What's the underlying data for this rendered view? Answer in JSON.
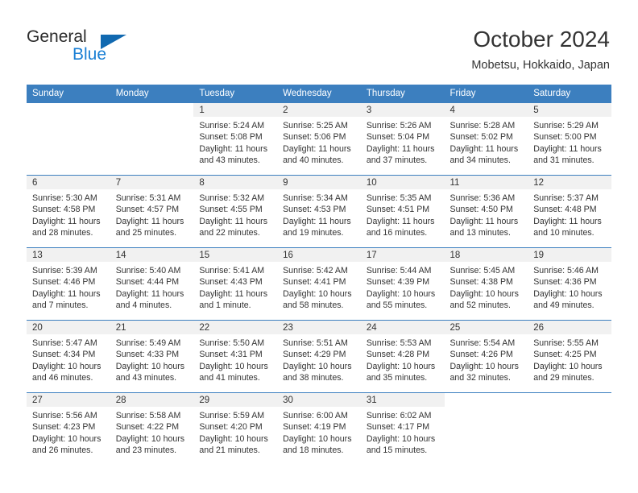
{
  "logo": {
    "word_top": "General",
    "word_bottom": "Blue",
    "triangle_color": "#1169b0",
    "blue_color": "#1a7fd4"
  },
  "header": {
    "title": "October 2024",
    "subtitle": "Mobetsu, Hokkaido, Japan"
  },
  "theme": {
    "header_blue": "#3c7fbf",
    "daynum_band": "#f1f1f1",
    "text": "#333333"
  },
  "weekday_headers": [
    "Sunday",
    "Monday",
    "Tuesday",
    "Wednesday",
    "Thursday",
    "Friday",
    "Saturday"
  ],
  "weeks": [
    [
      {
        "day": "",
        "sunrise": "",
        "sunset": "",
        "daylight_line1": "",
        "daylight_line2": ""
      },
      {
        "day": "",
        "sunrise": "",
        "sunset": "",
        "daylight_line1": "",
        "daylight_line2": ""
      },
      {
        "day": "1",
        "sunrise": "Sunrise: 5:24 AM",
        "sunset": "Sunset: 5:08 PM",
        "daylight_line1": "Daylight: 11 hours",
        "daylight_line2": "and 43 minutes."
      },
      {
        "day": "2",
        "sunrise": "Sunrise: 5:25 AM",
        "sunset": "Sunset: 5:06 PM",
        "daylight_line1": "Daylight: 11 hours",
        "daylight_line2": "and 40 minutes."
      },
      {
        "day": "3",
        "sunrise": "Sunrise: 5:26 AM",
        "sunset": "Sunset: 5:04 PM",
        "daylight_line1": "Daylight: 11 hours",
        "daylight_line2": "and 37 minutes."
      },
      {
        "day": "4",
        "sunrise": "Sunrise: 5:28 AM",
        "sunset": "Sunset: 5:02 PM",
        "daylight_line1": "Daylight: 11 hours",
        "daylight_line2": "and 34 minutes."
      },
      {
        "day": "5",
        "sunrise": "Sunrise: 5:29 AM",
        "sunset": "Sunset: 5:00 PM",
        "daylight_line1": "Daylight: 11 hours",
        "daylight_line2": "and 31 minutes."
      }
    ],
    [
      {
        "day": "6",
        "sunrise": "Sunrise: 5:30 AM",
        "sunset": "Sunset: 4:58 PM",
        "daylight_line1": "Daylight: 11 hours",
        "daylight_line2": "and 28 minutes."
      },
      {
        "day": "7",
        "sunrise": "Sunrise: 5:31 AM",
        "sunset": "Sunset: 4:57 PM",
        "daylight_line1": "Daylight: 11 hours",
        "daylight_line2": "and 25 minutes."
      },
      {
        "day": "8",
        "sunrise": "Sunrise: 5:32 AM",
        "sunset": "Sunset: 4:55 PM",
        "daylight_line1": "Daylight: 11 hours",
        "daylight_line2": "and 22 minutes."
      },
      {
        "day": "9",
        "sunrise": "Sunrise: 5:34 AM",
        "sunset": "Sunset: 4:53 PM",
        "daylight_line1": "Daylight: 11 hours",
        "daylight_line2": "and 19 minutes."
      },
      {
        "day": "10",
        "sunrise": "Sunrise: 5:35 AM",
        "sunset": "Sunset: 4:51 PM",
        "daylight_line1": "Daylight: 11 hours",
        "daylight_line2": "and 16 minutes."
      },
      {
        "day": "11",
        "sunrise": "Sunrise: 5:36 AM",
        "sunset": "Sunset: 4:50 PM",
        "daylight_line1": "Daylight: 11 hours",
        "daylight_line2": "and 13 minutes."
      },
      {
        "day": "12",
        "sunrise": "Sunrise: 5:37 AM",
        "sunset": "Sunset: 4:48 PM",
        "daylight_line1": "Daylight: 11 hours",
        "daylight_line2": "and 10 minutes."
      }
    ],
    [
      {
        "day": "13",
        "sunrise": "Sunrise: 5:39 AM",
        "sunset": "Sunset: 4:46 PM",
        "daylight_line1": "Daylight: 11 hours",
        "daylight_line2": "and 7 minutes."
      },
      {
        "day": "14",
        "sunrise": "Sunrise: 5:40 AM",
        "sunset": "Sunset: 4:44 PM",
        "daylight_line1": "Daylight: 11 hours",
        "daylight_line2": "and 4 minutes."
      },
      {
        "day": "15",
        "sunrise": "Sunrise: 5:41 AM",
        "sunset": "Sunset: 4:43 PM",
        "daylight_line1": "Daylight: 11 hours",
        "daylight_line2": "and 1 minute."
      },
      {
        "day": "16",
        "sunrise": "Sunrise: 5:42 AM",
        "sunset": "Sunset: 4:41 PM",
        "daylight_line1": "Daylight: 10 hours",
        "daylight_line2": "and 58 minutes."
      },
      {
        "day": "17",
        "sunrise": "Sunrise: 5:44 AM",
        "sunset": "Sunset: 4:39 PM",
        "daylight_line1": "Daylight: 10 hours",
        "daylight_line2": "and 55 minutes."
      },
      {
        "day": "18",
        "sunrise": "Sunrise: 5:45 AM",
        "sunset": "Sunset: 4:38 PM",
        "daylight_line1": "Daylight: 10 hours",
        "daylight_line2": "and 52 minutes."
      },
      {
        "day": "19",
        "sunrise": "Sunrise: 5:46 AM",
        "sunset": "Sunset: 4:36 PM",
        "daylight_line1": "Daylight: 10 hours",
        "daylight_line2": "and 49 minutes."
      }
    ],
    [
      {
        "day": "20",
        "sunrise": "Sunrise: 5:47 AM",
        "sunset": "Sunset: 4:34 PM",
        "daylight_line1": "Daylight: 10 hours",
        "daylight_line2": "and 46 minutes."
      },
      {
        "day": "21",
        "sunrise": "Sunrise: 5:49 AM",
        "sunset": "Sunset: 4:33 PM",
        "daylight_line1": "Daylight: 10 hours",
        "daylight_line2": "and 43 minutes."
      },
      {
        "day": "22",
        "sunrise": "Sunrise: 5:50 AM",
        "sunset": "Sunset: 4:31 PM",
        "daylight_line1": "Daylight: 10 hours",
        "daylight_line2": "and 41 minutes."
      },
      {
        "day": "23",
        "sunrise": "Sunrise: 5:51 AM",
        "sunset": "Sunset: 4:29 PM",
        "daylight_line1": "Daylight: 10 hours",
        "daylight_line2": "and 38 minutes."
      },
      {
        "day": "24",
        "sunrise": "Sunrise: 5:53 AM",
        "sunset": "Sunset: 4:28 PM",
        "daylight_line1": "Daylight: 10 hours",
        "daylight_line2": "and 35 minutes."
      },
      {
        "day": "25",
        "sunrise": "Sunrise: 5:54 AM",
        "sunset": "Sunset: 4:26 PM",
        "daylight_line1": "Daylight: 10 hours",
        "daylight_line2": "and 32 minutes."
      },
      {
        "day": "26",
        "sunrise": "Sunrise: 5:55 AM",
        "sunset": "Sunset: 4:25 PM",
        "daylight_line1": "Daylight: 10 hours",
        "daylight_line2": "and 29 minutes."
      }
    ],
    [
      {
        "day": "27",
        "sunrise": "Sunrise: 5:56 AM",
        "sunset": "Sunset: 4:23 PM",
        "daylight_line1": "Daylight: 10 hours",
        "daylight_line2": "and 26 minutes."
      },
      {
        "day": "28",
        "sunrise": "Sunrise: 5:58 AM",
        "sunset": "Sunset: 4:22 PM",
        "daylight_line1": "Daylight: 10 hours",
        "daylight_line2": "and 23 minutes."
      },
      {
        "day": "29",
        "sunrise": "Sunrise: 5:59 AM",
        "sunset": "Sunset: 4:20 PM",
        "daylight_line1": "Daylight: 10 hours",
        "daylight_line2": "and 21 minutes."
      },
      {
        "day": "30",
        "sunrise": "Sunrise: 6:00 AM",
        "sunset": "Sunset: 4:19 PM",
        "daylight_line1": "Daylight: 10 hours",
        "daylight_line2": "and 18 minutes."
      },
      {
        "day": "31",
        "sunrise": "Sunrise: 6:02 AM",
        "sunset": "Sunset: 4:17 PM",
        "daylight_line1": "Daylight: 10 hours",
        "daylight_line2": "and 15 minutes."
      },
      {
        "day": "",
        "sunrise": "",
        "sunset": "",
        "daylight_line1": "",
        "daylight_line2": ""
      },
      {
        "day": "",
        "sunrise": "",
        "sunset": "",
        "daylight_line1": "",
        "daylight_line2": ""
      }
    ]
  ]
}
